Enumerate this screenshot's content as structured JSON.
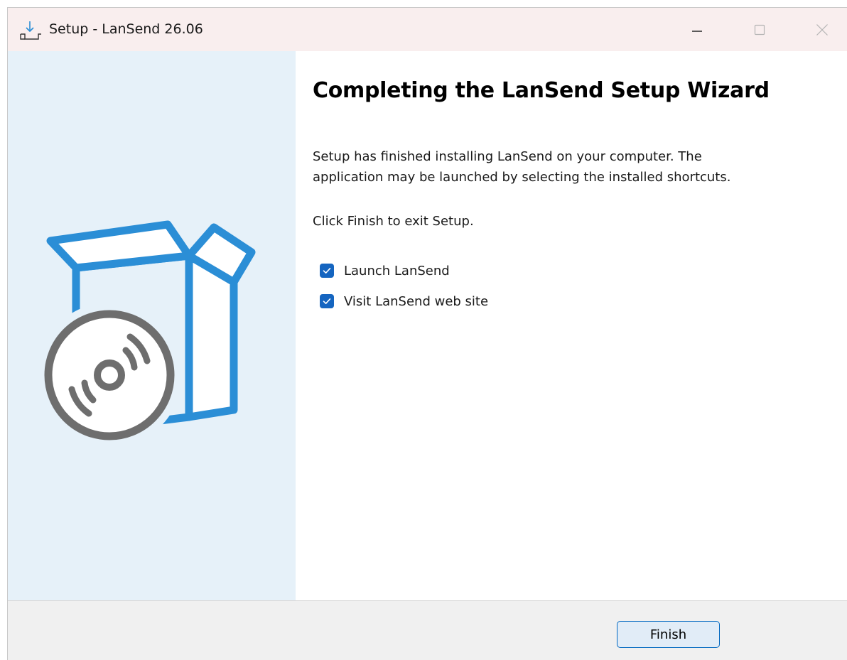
{
  "window": {
    "title": "Setup - LanSend 26.06"
  },
  "icons": {
    "app": "download-tray-icon",
    "minimize": "minimize-icon",
    "maximize": "maximize-icon",
    "close": "close-icon",
    "illustration": "open-box-with-disc-icon",
    "check": "checkmark-icon"
  },
  "main": {
    "heading": "Completing the LanSend Setup Wizard",
    "description_line1": "Setup has finished installing LanSend on your computer. The",
    "description_line2": "application may be launched by selecting the installed shortcuts.",
    "hint": "Click Finish to exit Setup.",
    "options": [
      {
        "label": "Launch LanSend",
        "checked": true
      },
      {
        "label": "Visit LanSend web site",
        "checked": true
      }
    ]
  },
  "footer": {
    "finish_label": "Finish"
  },
  "colors": {
    "titlebar": "#f9eeee",
    "sidebar": "#e6f1f9",
    "accent_blue": "#2b8ed6",
    "disc_gray": "#6e6e6e",
    "checkbox": "#1565c0",
    "button_border": "#0067c0",
    "footer": "#f0f0f0"
  }
}
